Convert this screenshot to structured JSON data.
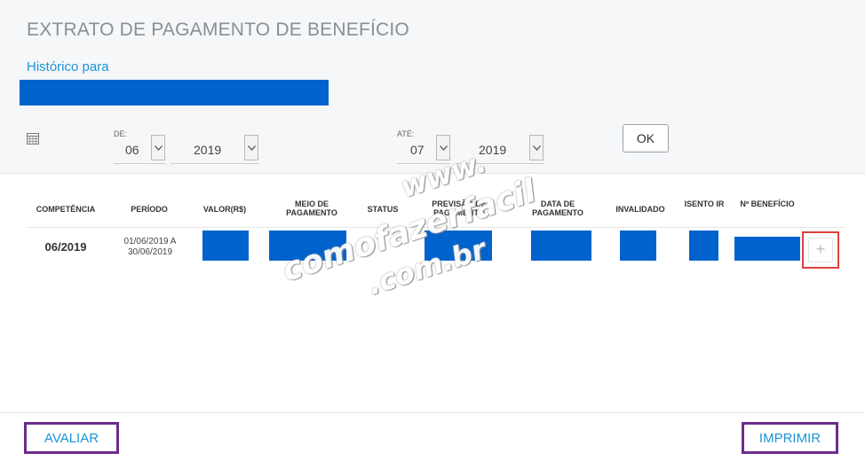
{
  "header": {
    "title": "EXTRATO DE PAGAMENTO DE BENEFÍCIO",
    "subtitle": "Histórico para"
  },
  "filters": {
    "calendar_icon": "calendar-icon",
    "from_label": "DE:",
    "from_month": "06",
    "from_year": "2019",
    "to_label": "ATÉ:",
    "to_month": "07",
    "to_year": "2019",
    "ok_label": "OK"
  },
  "table": {
    "columns": [
      "COMPETÊNCIA",
      "PERÍODO",
      "VALOR(R$)",
      "MEIO DE PAGAMENTO",
      "STATUS",
      "PREVISÃO DE PAGAMENTO",
      "DATA DE PAGAMENTO",
      "INVALIDADO",
      "ISENTO IR",
      "Nº BENEFÍCIO"
    ],
    "rows": [
      {
        "competencia": "06/2019",
        "periodo_inicio": "01/06/2019 A",
        "periodo_fim": "30/06/2019",
        "status": "-",
        "expand": "+"
      }
    ]
  },
  "footer": {
    "avaliar": "AVALIAR",
    "imprimir": "IMPRIMIR"
  },
  "watermark": {
    "line1": "www.",
    "line2": "comofazerfacil",
    "line3": ".com.br"
  },
  "colors": {
    "redaction": "#0062cc",
    "link": "#1a95d6",
    "highlight_purple": "#6b2c8c",
    "highlight_red": "#e0403c"
  }
}
